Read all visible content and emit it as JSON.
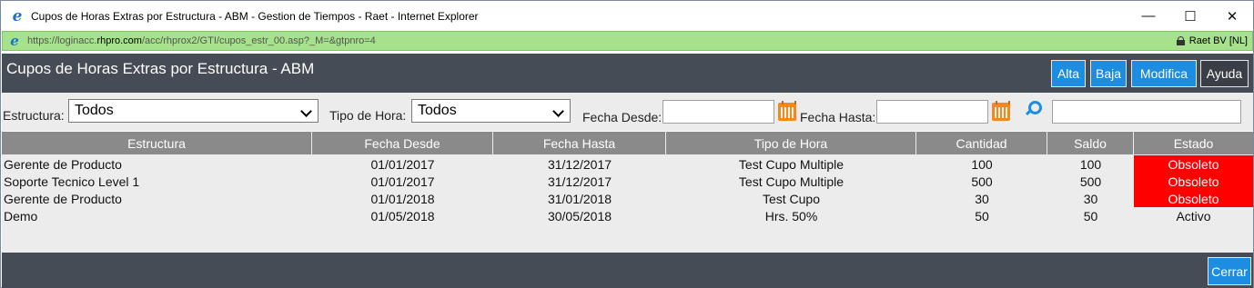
{
  "window": {
    "title": "Cupos de Horas Extras por Estructura - ABM - Gestion de Tiempos - Raet - Internet Explorer",
    "minimize": "—",
    "maximize": "☐",
    "close": "✕"
  },
  "address": {
    "url_prefix": "https://loginacc.",
    "url_domain": "rhpro.com",
    "url_path": "/acc/rhprox2/GTI/cupos_estr_00.asp?_M=&gtpnro=4",
    "identity": "Raet BV [NL]"
  },
  "header": {
    "title": "Cupos de Horas Extras por Estructura - ABM",
    "buttons": {
      "alta": "Alta",
      "baja": "Baja",
      "modifica": "Modifica",
      "ayuda": "Ayuda"
    }
  },
  "filters": {
    "estructura_label": "Estructura:",
    "estructura_value": "Todos",
    "tipo_label": "Tipo de Hora:",
    "tipo_value": "Todos",
    "desde_label": "Fecha Desde:",
    "desde_value": "",
    "hasta_label": "Fecha Hasta:",
    "hasta_value": "",
    "search_value": ""
  },
  "table": {
    "columns": [
      "Estructura",
      "Fecha Desde",
      "Fecha Hasta",
      "Tipo de Hora",
      "Cantidad",
      "Saldo",
      "Estado"
    ],
    "rows": [
      {
        "estructura": "Gerente de Producto",
        "desde": "01/01/2017",
        "hasta": "31/12/2017",
        "tipo": "Test Cupo Multiple",
        "cantidad": "100",
        "saldo": "100",
        "estado": "Obsoleto"
      },
      {
        "estructura": "Soporte Tecnico Level 1",
        "desde": "01/01/2017",
        "hasta": "31/12/2017",
        "tipo": "Test Cupo Multiple",
        "cantidad": "500",
        "saldo": "500",
        "estado": "Obsoleto"
      },
      {
        "estructura": "Gerente de Producto",
        "desde": "01/01/2018",
        "hasta": "31/01/2018",
        "tipo": "Test Cupo",
        "cantidad": "30",
        "saldo": "30",
        "estado": "Obsoleto"
      },
      {
        "estructura": "Demo",
        "desde": "01/05/2018",
        "hasta": "30/05/2018",
        "tipo": "Hrs. 50%",
        "cantidad": "50",
        "saldo": "50",
        "estado": "Activo"
      }
    ]
  },
  "footer": {
    "cerrar": "Cerrar"
  },
  "colors": {
    "header_bg": "#464c55",
    "button_blue": "#1c8de0",
    "obsolete_red": "#ff0000",
    "address_green": "#a6e28c"
  }
}
